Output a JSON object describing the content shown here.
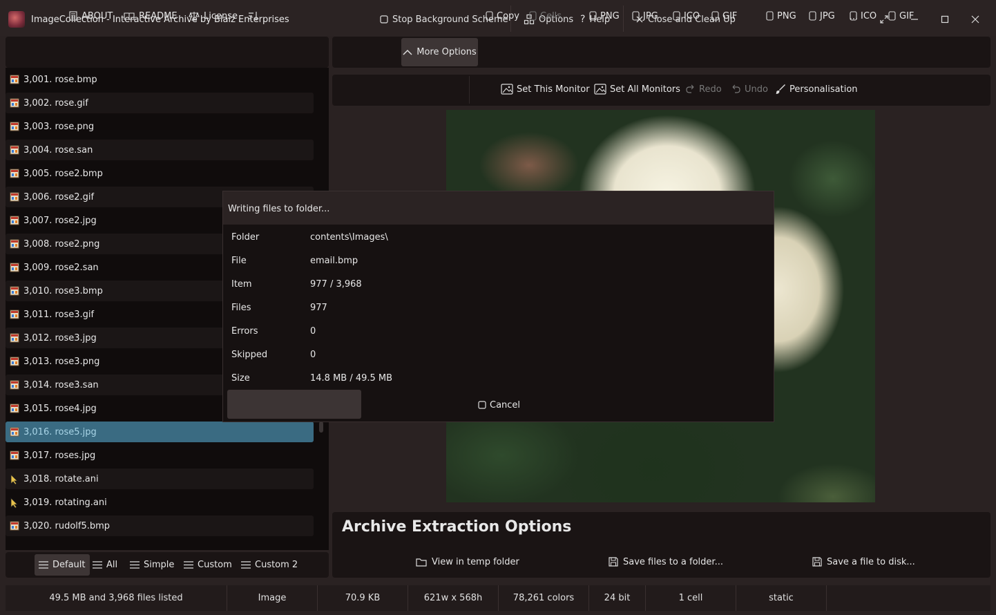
{
  "window": {
    "title": "ImageCollection  -  Interactive Archive by Blaiz Enterprises",
    "stop_background": "Stop Background Scheme",
    "options": "Options",
    "help": "Help",
    "close_cleanup": "Close and Clean Up",
    "more": "···"
  },
  "left_toolbar": {
    "about": "ABOUT",
    "readme": "README",
    "license": "License"
  },
  "right_toolbar": {
    "more_options": "More Options",
    "copy": "Copy",
    "cells": "Cells",
    "copy_formats": [
      "PNG",
      "JPG",
      "ICO",
      "GIF"
    ],
    "save_formats": [
      "PNG",
      "JPG",
      "ICO",
      "GIF"
    ]
  },
  "toolbar2": {
    "set_this_monitor": "Set This Monitor",
    "set_all_monitors": "Set All Monitors",
    "redo": "Redo",
    "undo": "Undo",
    "personalisation": "Personalisation"
  },
  "files": [
    {
      "label": "3,001.  rose.bmp",
      "type": "image"
    },
    {
      "label": "3,002.  rose.gif",
      "type": "image"
    },
    {
      "label": "3,003.  rose.png",
      "type": "image"
    },
    {
      "label": "3,004.  rose.san",
      "type": "image"
    },
    {
      "label": "3,005.  rose2.bmp",
      "type": "image"
    },
    {
      "label": "3,006.  rose2.gif",
      "type": "image"
    },
    {
      "label": "3,007.  rose2.jpg",
      "type": "image"
    },
    {
      "label": "3,008.  rose2.png",
      "type": "image"
    },
    {
      "label": "3,009.  rose2.san",
      "type": "image"
    },
    {
      "label": "3,010.  rose3.bmp",
      "type": "image"
    },
    {
      "label": "3,011.  rose3.gif",
      "type": "image"
    },
    {
      "label": "3,012.  rose3.jpg",
      "type": "image"
    },
    {
      "label": "3,013.  rose3.png",
      "type": "image"
    },
    {
      "label": "3,014.  rose3.san",
      "type": "image"
    },
    {
      "label": "3,015.  rose4.jpg",
      "type": "image"
    },
    {
      "label": "3,016.  rose5.jpg",
      "type": "image",
      "selected": true
    },
    {
      "label": "3,017.  roses.jpg",
      "type": "image"
    },
    {
      "label": "3,018.  rotate.ani",
      "type": "cursor"
    },
    {
      "label": "3,019.  rotating.ani",
      "type": "cursor"
    },
    {
      "label": "3,020.  rudolf5.bmp",
      "type": "image"
    }
  ],
  "view_tabs": {
    "default": "Default",
    "all": "All",
    "simple": "Simple",
    "custom": "Custom",
    "custom2": "Custom 2"
  },
  "dialog": {
    "title": "Writing files to folder...",
    "rows": [
      {
        "label": "Folder",
        "value": "contents\\Images\\"
      },
      {
        "label": "File",
        "value": "email.bmp"
      },
      {
        "label": "Item",
        "value": "977 / 3,968"
      },
      {
        "label": "Files",
        "value": "977"
      },
      {
        "label": "Errors",
        "value": "0"
      },
      {
        "label": "Skipped",
        "value": "0"
      },
      {
        "label": "Size",
        "value": "14.8 MB / 49.5 MB"
      }
    ],
    "cancel": "Cancel"
  },
  "archive": {
    "title": "Archive Extraction Options",
    "view_temp": "View in temp folder",
    "save_folder": "Save files to a folder...",
    "save_disk": "Save a file to disk..."
  },
  "status": {
    "summary": "49.5 MB and 3,968 files listed",
    "kind": "Image",
    "size": "70.9 KB",
    "dimensions": "621w x 568h",
    "colors": "78,261 colors",
    "bits": "24 bit",
    "cells": "1 cell",
    "anim": "static"
  },
  "colors": {
    "selected_row": "#3a6b82",
    "selected_text": "#a8d4e6",
    "panel_bg": "#1a1414",
    "titlebar_bg": "#2b2323"
  }
}
